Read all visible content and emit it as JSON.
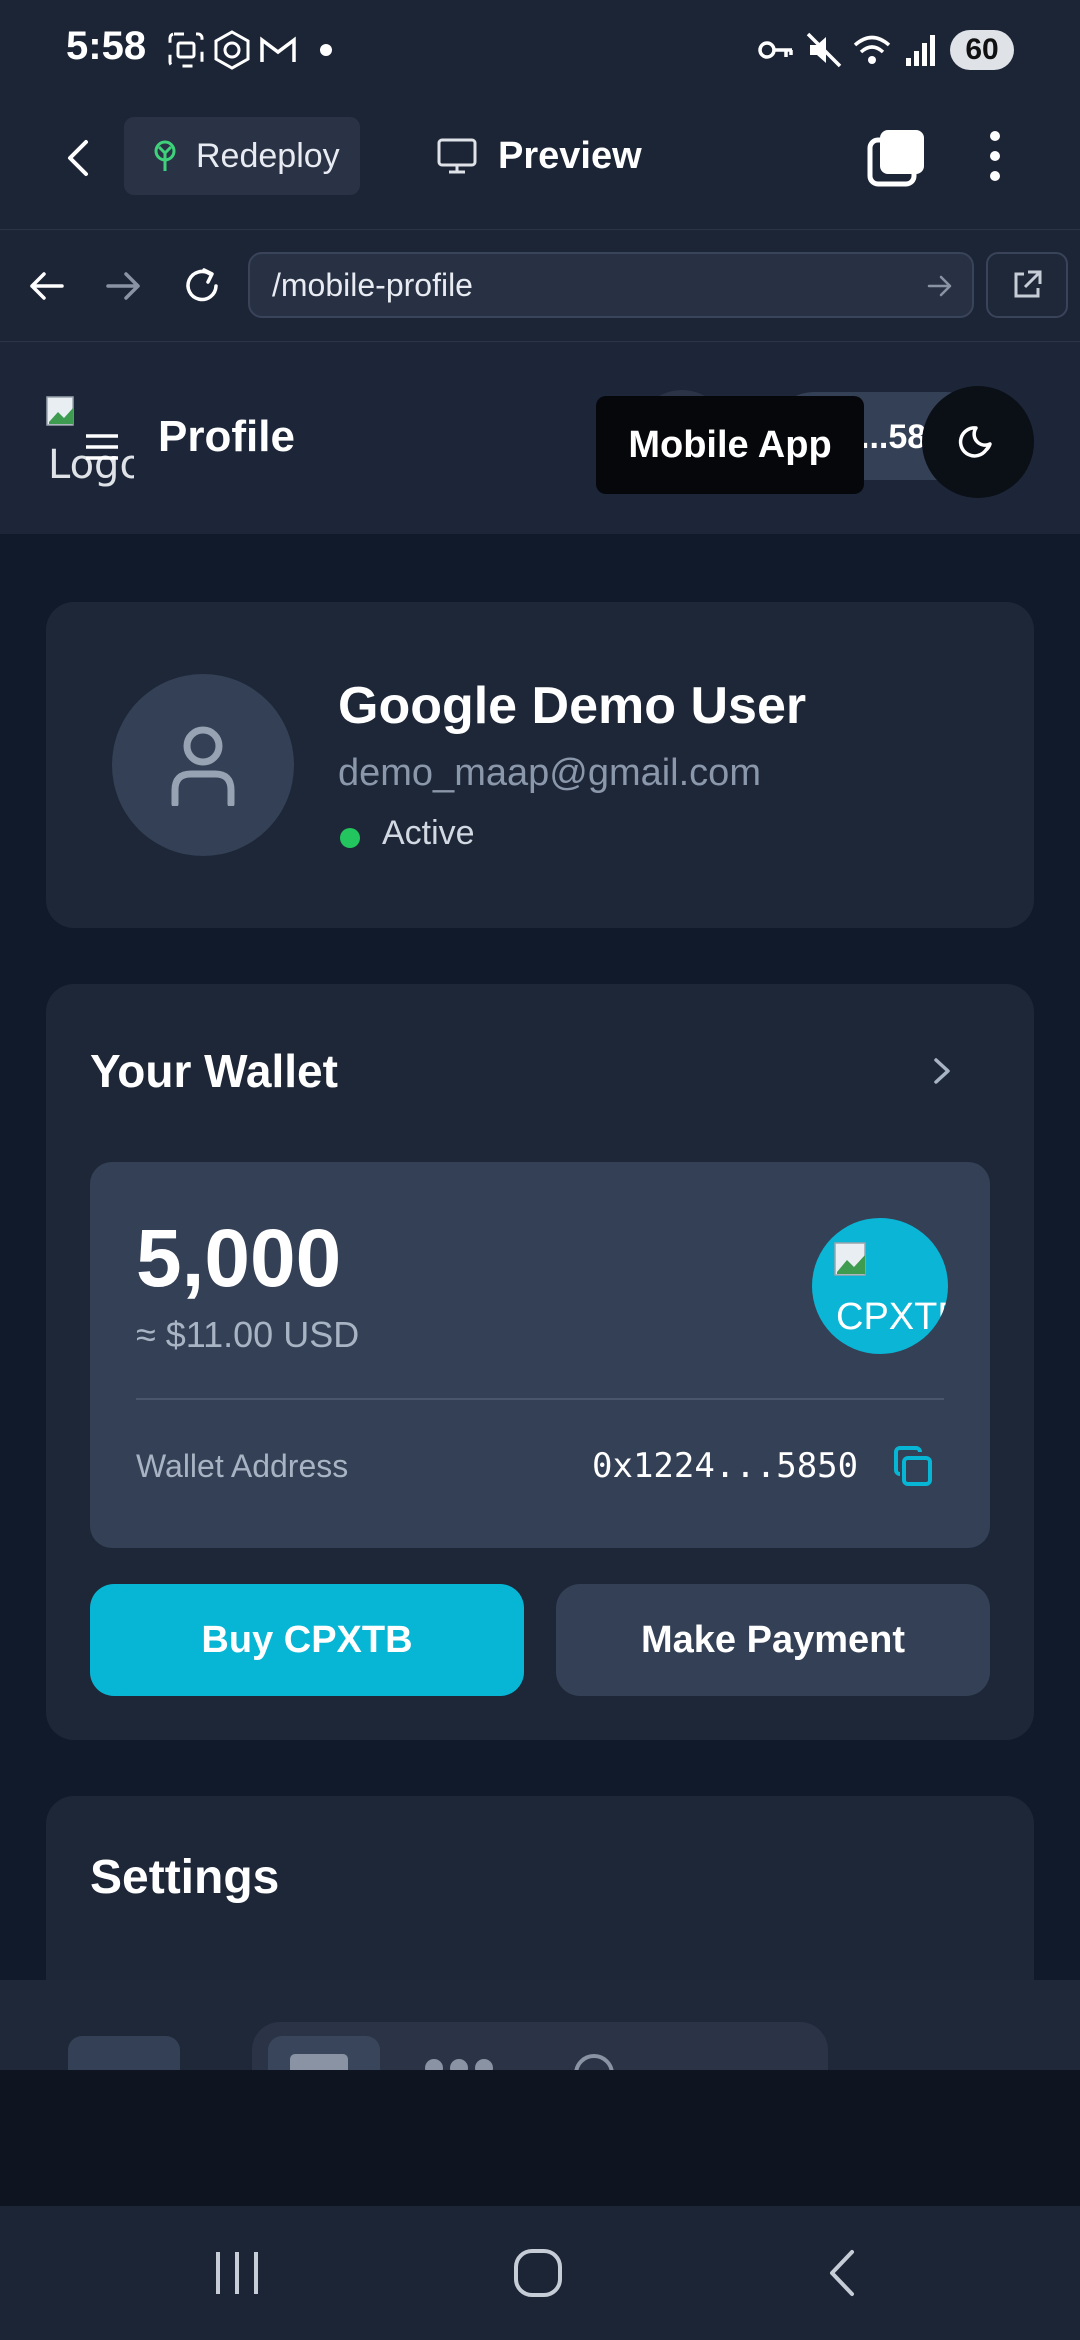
{
  "status_bar": {
    "time": "5:58",
    "battery": "60"
  },
  "app_bar": {
    "redeploy_label": "Redeploy",
    "preview_label": "Preview"
  },
  "browser": {
    "url": "/mobile-profile"
  },
  "site_header": {
    "logo_alt": "Logo",
    "title": "Profile",
    "wallet_chip": "...58",
    "tooltip": "Mobile App"
  },
  "profile": {
    "name": "Google Demo User",
    "email": "demo_maap@gmail.com",
    "status": "Active"
  },
  "wallet": {
    "title": "Your Wallet",
    "balance": "5,000",
    "balance_usd": "≈ $11.00 USD",
    "token_alt": "CPXTB",
    "address_label": "Wallet Address",
    "address_value": "0x1224...5850",
    "buy_label": "Buy CPXTB",
    "pay_label": "Make Payment"
  },
  "settings": {
    "title": "Settings"
  },
  "colors": {
    "accent": "#06b6d4",
    "background": "#111a2b",
    "card": "#1d2738",
    "active_dot": "#22c55e"
  }
}
